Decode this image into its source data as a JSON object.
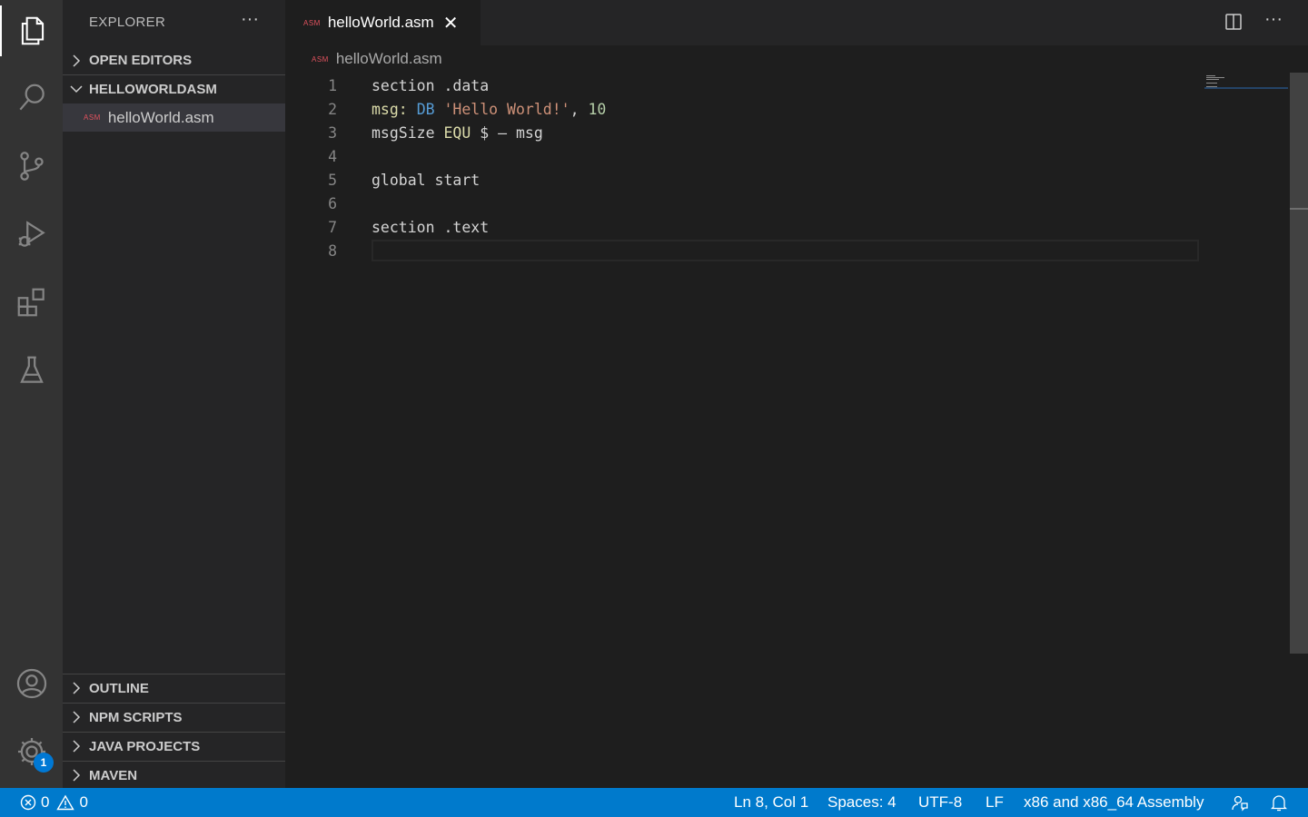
{
  "sidebar": {
    "title": "EXPLORER",
    "more": "···",
    "sections": {
      "open_editors": "OPEN EDITORS",
      "folder": "HELLOWORLDASM",
      "outline": "OUTLINE",
      "npm_scripts": "NPM SCRIPTS",
      "java_projects": "JAVA PROJECTS",
      "maven": "MAVEN"
    },
    "file": {
      "icon_label": "ASM",
      "name": "helloWorld.asm"
    }
  },
  "activity": {
    "settings_badge": "1"
  },
  "tab": {
    "icon_label": "ASM",
    "title": "helloWorld.asm",
    "close": "✕"
  },
  "editor_actions": {
    "more": "···"
  },
  "breadcrumb": {
    "icon_label": "ASM",
    "file": "helloWorld.asm"
  },
  "editor": {
    "line_numbers": [
      "1",
      "2",
      "3",
      "4",
      "5",
      "6",
      "7",
      "8"
    ],
    "line1": "section .data",
    "line2": {
      "label": "msg:",
      "sp1": " ",
      "kw": "DB",
      "sp2": " ",
      "str": "'Hello World!'",
      "sep": ", ",
      "num": "10"
    },
    "line3": {
      "a": "msgSize ",
      "equ": "EQU",
      "b": " $ – msg"
    },
    "line5": "global start",
    "line7": "section .text"
  },
  "status": {
    "errors": "0",
    "warnings": "0",
    "position": "Ln 8, Col 1",
    "spaces": "Spaces: 4",
    "encoding": "UTF-8",
    "eol": "LF",
    "language": "x86 and x86_64 Assembly"
  },
  "colors": {
    "activity_bar": "#333333",
    "sidebar": "#252526",
    "editor": "#1e1e1e",
    "status_bar": "#007acc",
    "asm_icon": "#e0525e"
  }
}
